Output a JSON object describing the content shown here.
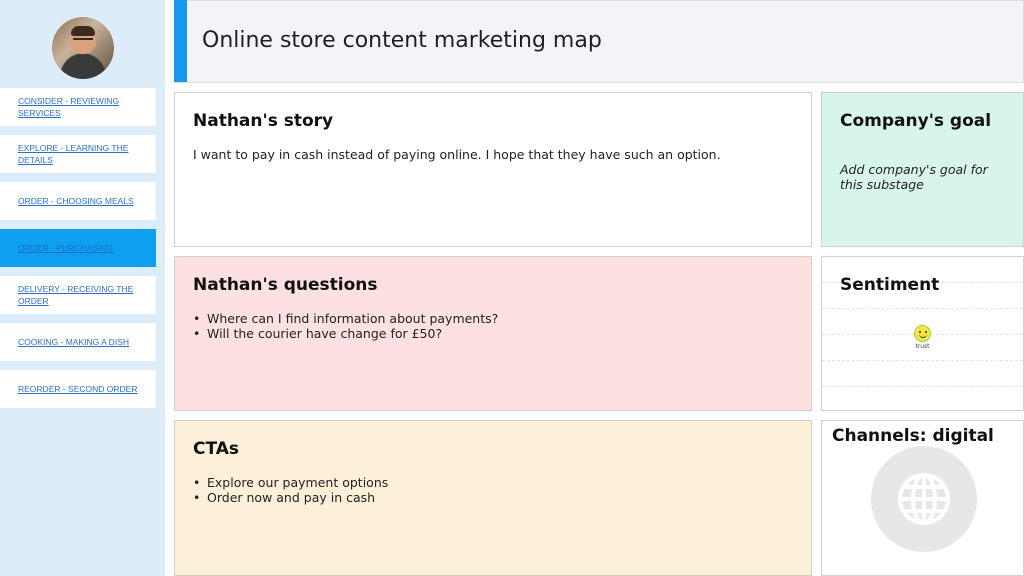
{
  "header": {
    "title": "Online store content marketing map"
  },
  "sidebar": {
    "items": [
      {
        "label": "CONSIDER - REVIEWING SERVICES",
        "active": false
      },
      {
        "label": "EXPLORE - LEARNING THE DETAILS",
        "active": false
      },
      {
        "label": "ORDER - CHOOSING MEALS",
        "active": false
      },
      {
        "label": "ORDER - PURCHASING",
        "active": true
      },
      {
        "label": "DELIVERY - RECEIVING THE ORDER",
        "active": false
      },
      {
        "label": "COOKING - MAKING A DISH",
        "active": false
      },
      {
        "label": "REORDER - SECOND ORDER",
        "active": false
      }
    ]
  },
  "story": {
    "title": "Nathan's story",
    "text": "I want to pay in cash instead of paying online. I hope that they have such an option."
  },
  "goal": {
    "title": "Company's goal",
    "text": "Add company's goal for this substage"
  },
  "questions": {
    "title": "Nathan's questions",
    "items": [
      "Where can I find information about payments?",
      "Will the courier have change for £50?"
    ]
  },
  "sentiment": {
    "title": "Sentiment",
    "emoji_label": "trust",
    "icon": "smiley-face-icon"
  },
  "ctas": {
    "title": "CTAs",
    "items": [
      "Explore our payment options",
      "Order now and pay in cash"
    ]
  },
  "channels": {
    "title": "Channels: digital",
    "icon": "globe-icon"
  },
  "colors": {
    "accent": "#1598ee",
    "sidebar_bg": "#dcecf9",
    "active_item": "#0f9ff0",
    "goal_bg": "#d7f5ea",
    "questions_bg": "#fde1e1",
    "ctas_bg": "#fdf0d8"
  }
}
